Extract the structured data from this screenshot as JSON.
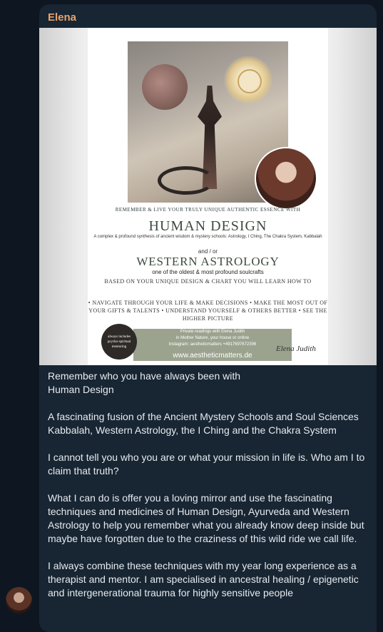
{
  "message": {
    "sender": "Elena",
    "poster": {
      "tagline": "REMEMBER & LIVE YOUR TRULY UNIQUE AUTHENTIC ESSENCE WITH",
      "title1": "HUMAN DESIGN",
      "desc": "A complex & profound synthesis of ancient wisdom & mystery schools: Astrology, I Ching, The Chakra System, Kabbalah",
      "andor": "and / or",
      "title2": "WESTERN ASTROLOGY",
      "oldest": "one of the oldest & most profound soulcrafts",
      "based": "BASED ON YOUR UNIQUE DESIGN & CHART YOU WILL LEARN HOW TO",
      "bullets": "• NAVIGATE THROUGH YOUR LIFE & MAKE DECISIONS • MAKE THE MOST OUT OF YOUR GIFTS & TALENTS • UNDERSTAND YOURSELF & OTHERS BETTER • SEE THE HIGHER PICTURE",
      "private_line1": "Private readings with Elena Judith",
      "private_line2": "in Mother Nature, your house or online",
      "private_line3": "Instagram: aestheticmatters +4917697672396",
      "url": "www.aestheticmatters.de",
      "badge": "always includes psycho-spiritual mentoring",
      "signature": "Elena Judith"
    },
    "caption": [
      "Remember who you have always been with\nHuman Design",
      "A fascinating fusion of the Ancient Mystery Schools and Soul Sciences Kabbalah, Western Astrology, the I Ching and the Chakra System",
      "I cannot tell you who you are or what your mission in life is. Who am I to claim that truth?",
      "What I can do is offer you a loving mirror and use the fascinating techniques and medicines of Human Design, Ayurveda and Western Astrology to help you remember what you already know deep inside but maybe have forgotten due to the craziness of this wild ride we call life.",
      "I always combine these techniques with my year long experience as a therapist and mentor. I am specialised in ancestral healing / epigenetic and intergenerational trauma for highly sensitive people"
    ]
  },
  "colors": {
    "background": "#0e1621",
    "bubble": "#182533",
    "sender": "#e9a36c",
    "text": "#e6ebef"
  }
}
